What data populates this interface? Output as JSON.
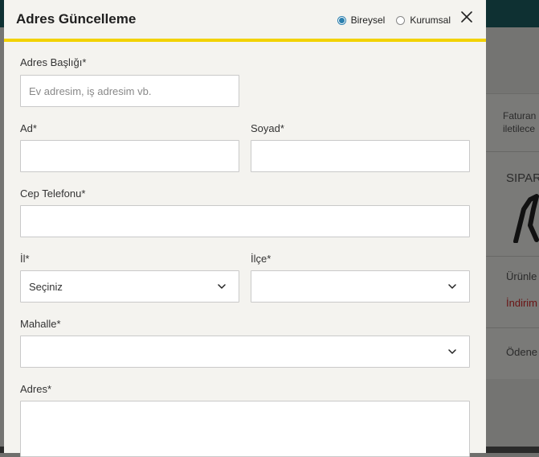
{
  "modal": {
    "title": "Adres Güncelleme",
    "type_options": [
      {
        "label": "Bireysel",
        "selected": true
      },
      {
        "label": "Kurumsal",
        "selected": false
      }
    ],
    "close_icon": "close-icon"
  },
  "form": {
    "address_title": {
      "label": "Adres Başlığı*",
      "placeholder": "Ev adresim, iş adresim vb.",
      "value": ""
    },
    "first_name": {
      "label": "Ad*",
      "value": ""
    },
    "last_name": {
      "label": "Soyad*",
      "value": ""
    },
    "mobile_phone": {
      "label": "Cep Telefonu*",
      "value": ""
    },
    "city": {
      "label": "İl*",
      "selected": "Seçiniz"
    },
    "district": {
      "label": "İlçe*",
      "selected": ""
    },
    "neighborhood": {
      "label": "Mahalle*",
      "selected": ""
    },
    "address": {
      "label": "Adres*",
      "value": ""
    }
  },
  "background": {
    "side_text_1": "Faturan",
    "side_text_2": "iletilece",
    "side_text_3": "SIPAR",
    "side_text_4": "Ürünle",
    "side_text_5": "İndirim",
    "side_text_6": "Ödene"
  },
  "colors": {
    "accent": "#f2d200",
    "radio_selected": "#2b7fae",
    "topbar": "#0e3032"
  }
}
